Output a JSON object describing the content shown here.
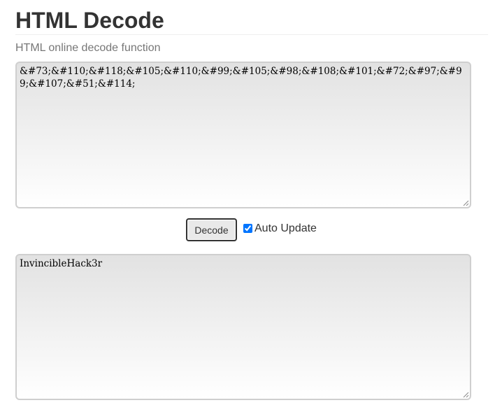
{
  "header": {
    "title": "HTML Decode",
    "subtitle": "HTML online decode function"
  },
  "input": {
    "value": "&#73;&#110;&#118;&#105;&#110;&#99;&#105;&#98;&#108;&#101;&#72;&#97;&#99;&#107;&#51;&#114;"
  },
  "controls": {
    "decode_label": "Decode",
    "auto_update_label": "Auto Update",
    "auto_update_checked": true
  },
  "output": {
    "value": "InvincibleHack3r"
  },
  "colors": {
    "checkbox_accent": "#0075ff",
    "title": "#333333",
    "subtitle": "#777777"
  }
}
